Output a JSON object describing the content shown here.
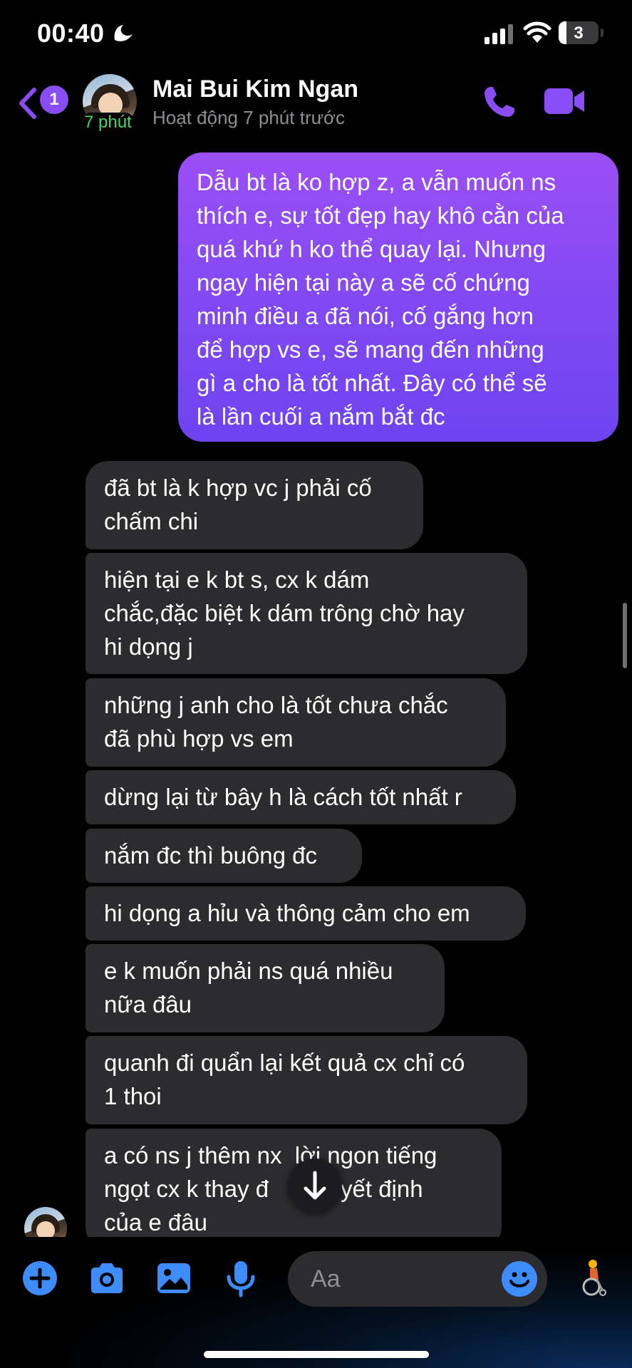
{
  "status_bar": {
    "time": "00:40",
    "battery_level": "3",
    "battery_fraction": 0.03,
    "icons": [
      "do-not-disturb-icon",
      "signal-icon",
      "wifi-icon",
      "battery-icon"
    ]
  },
  "header": {
    "back_badge": "1",
    "active_tag": "7 phút",
    "name": "Mai Bui Kim Ngan",
    "status": "Hoạt động 7 phút trước",
    "icons": [
      "back-chevron-icon",
      "phone-icon",
      "video-camera-icon"
    ]
  },
  "messages": {
    "outgoing": {
      "lines": [
        "Dẫu bt là ko hợp z, a vẫn muốn ns",
        "thích e, sự tốt đẹp hay khô cằn của",
        "quá khứ h ko thể quay lại. Nhưng",
        "ngay hiện tại này a sẽ cố chứng",
        "minh điều a đã nói, cố gắng hơn",
        "để hợp vs e, sẽ mang đến những",
        "gì a cho là tốt nhất. Đây có thể sẽ",
        "là lần cuối a nắm bắt đc"
      ]
    },
    "incoming": [
      {
        "lines": [
          "đã bt là k hợp vc j phải cố",
          "chấm chi"
        ]
      },
      {
        "lines": [
          "hiện tại e k bt s, cx k dám",
          "chắc,đặc biệt k dám trông chờ hay",
          "hi dọng j"
        ]
      },
      {
        "lines": [
          "những j anh cho là tốt chưa chắc",
          "đã phù hợp vs em"
        ]
      },
      {
        "lines": [
          "dừng lại từ bây h là cách tốt nhất r"
        ]
      },
      {
        "lines": [
          "nắm đc thì buông đc"
        ]
      },
      {
        "lines": [
          "hi dọng a hỉu và thông cảm cho em"
        ]
      },
      {
        "lines": [
          "e k muốn phải ns quá nhiều",
          "nữa đâu"
        ]
      },
      {
        "lines": [
          "quanh đi quẩn lại kết quả cx chỉ có",
          "1 thoi"
        ]
      },
      {
        "lines": [
          "a có ns j thêm nx  lời ngon tiếng",
          "ngọt cx k thay đ       quyết định",
          "của e đâu"
        ]
      }
    ]
  },
  "composer": {
    "placeholder": "Aa",
    "icons": [
      "plus-icon",
      "camera-icon",
      "photo-icon",
      "microphone-icon",
      "emoji-icon",
      "wheelchair-emoji-icon",
      "arrow-down-icon"
    ]
  },
  "colors": {
    "accent": "#8a4cf5",
    "outgoing_gradient_top": "#9b4ff4",
    "outgoing_gradient_bottom": "#6d44f0",
    "incoming_bubble": "#2c2c2e",
    "composer_icon": "#3d8cf9",
    "active_green": "#47d764"
  }
}
